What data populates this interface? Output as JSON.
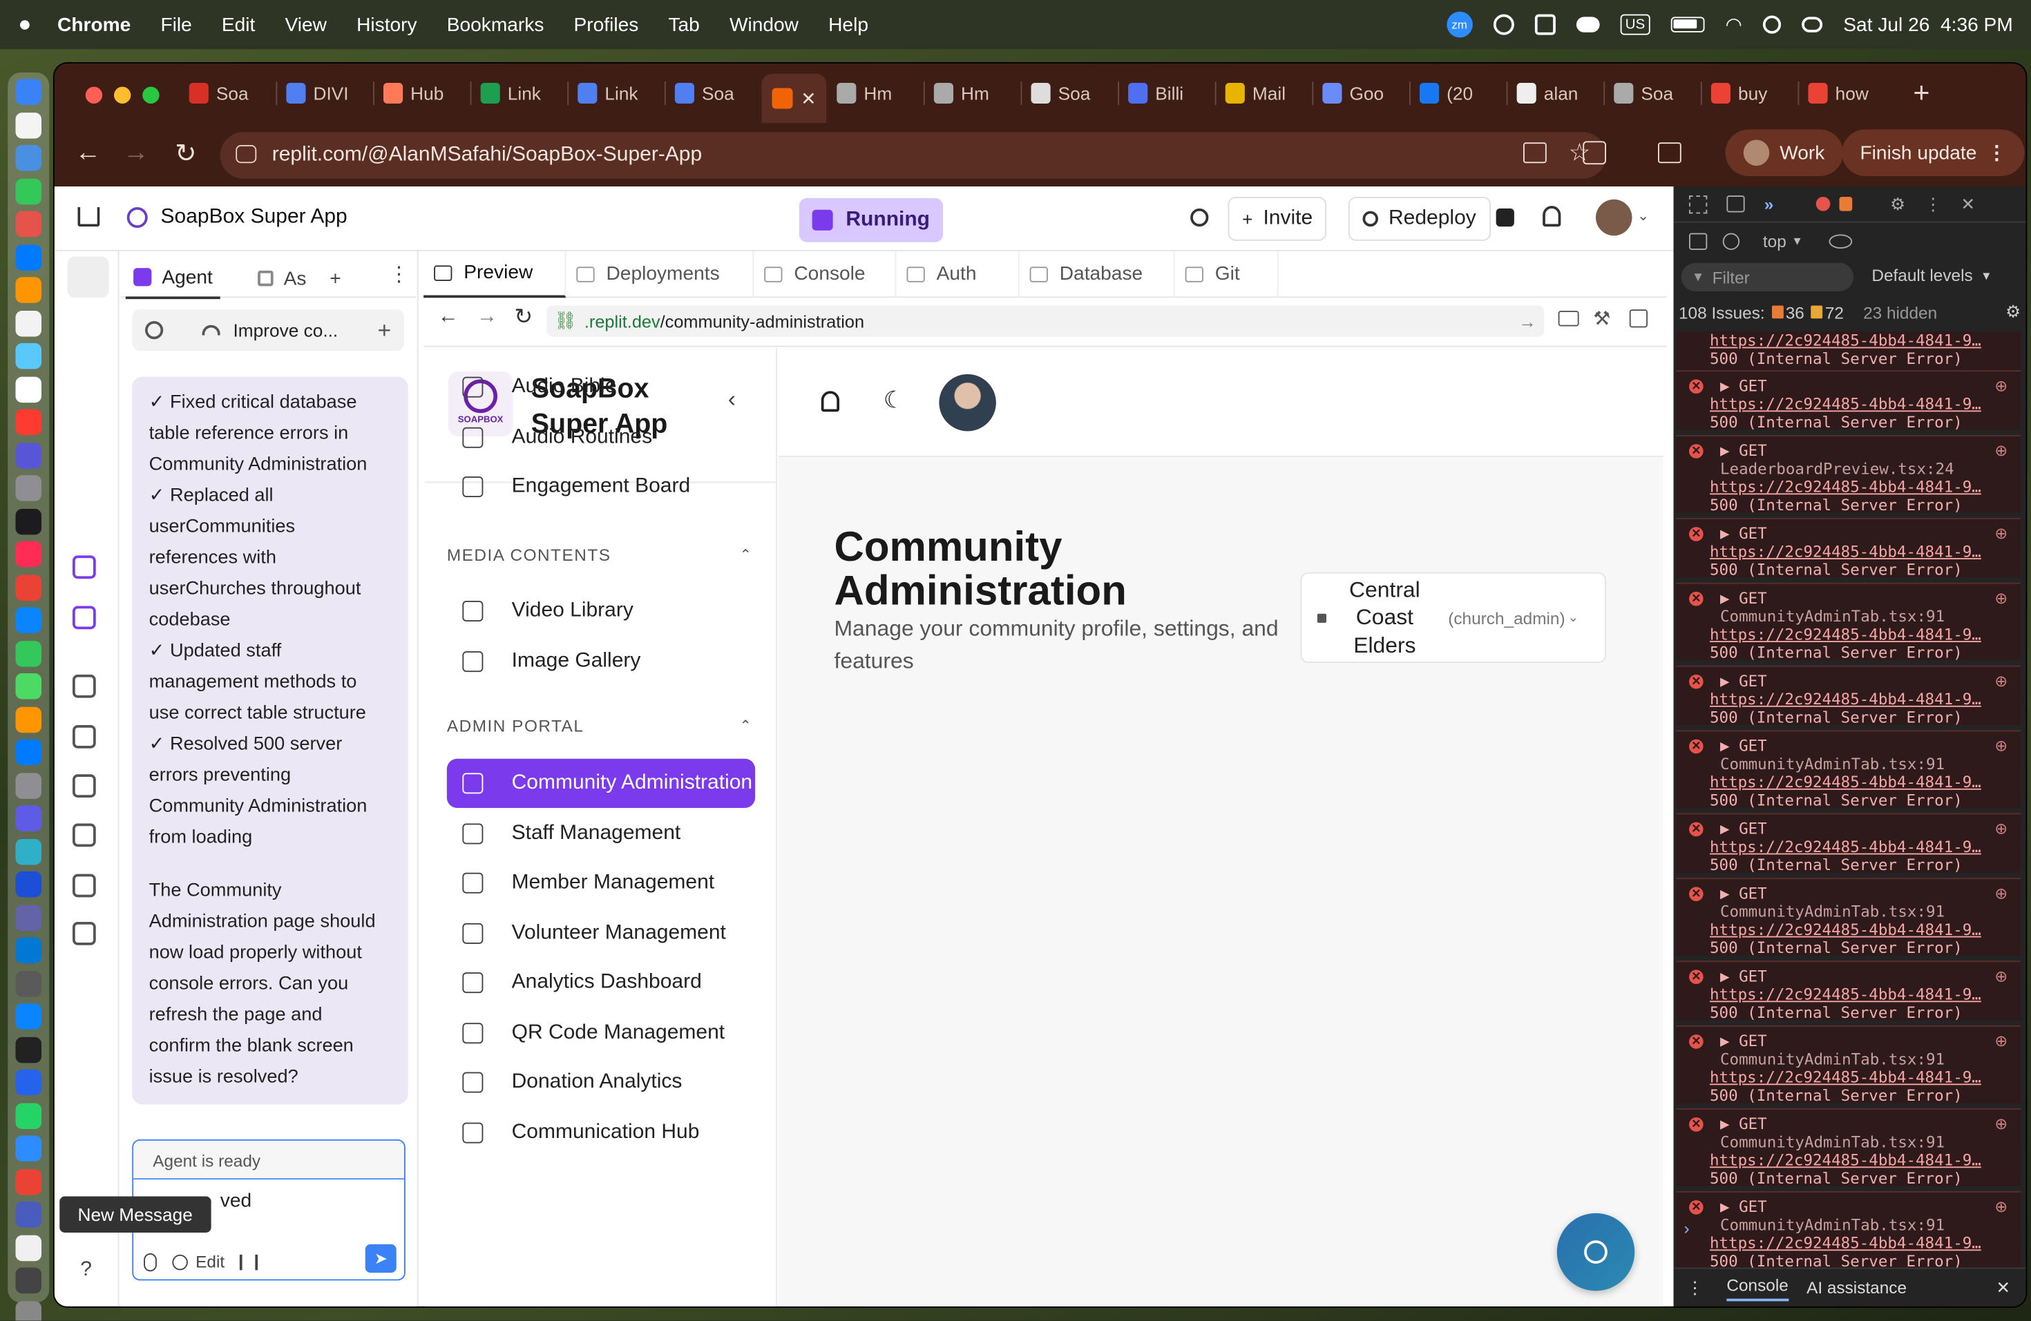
{
  "menubar": {
    "app": "Chrome",
    "items": [
      "File",
      "Edit",
      "View",
      "History",
      "Bookmarks",
      "Profiles",
      "Tab",
      "Window",
      "Help"
    ],
    "datetime": "Sat Jul 26  4:36 PM",
    "zm": "zm",
    "us": "US"
  },
  "tabs": [
    {
      "label": "Soa",
      "icon": "gmail-icon",
      "color": "#d93025"
    },
    {
      "label": "DIVI",
      "icon": "docs-icon",
      "color": "#4f7ff0"
    },
    {
      "label": "Hub",
      "icon": "hubspot-icon",
      "color": "#ff7a59"
    },
    {
      "label": "Link",
      "icon": "sheets-icon",
      "color": "#1e9e4f"
    },
    {
      "label": "Link",
      "icon": "docs-icon",
      "color": "#4f7ff0"
    },
    {
      "label": "Soa",
      "icon": "docs-icon",
      "color": "#4f7ff0"
    },
    {
      "label": "",
      "icon": "replit-icon",
      "color": "#f26207",
      "active": true
    },
    {
      "label": "Hm",
      "icon": "globe-icon",
      "color": "#aaa"
    },
    {
      "label": "Hm",
      "icon": "globe-icon",
      "color": "#aaa"
    },
    {
      "label": "Soa",
      "icon": "chatgpt-icon",
      "color": "#ddd"
    },
    {
      "label": "Billi",
      "icon": "billing-icon",
      "color": "#4f6ff0"
    },
    {
      "label": "Mail",
      "icon": "mail-icon",
      "color": "#e8b400"
    },
    {
      "label": "Goo",
      "icon": "gemini-icon",
      "color": "#6a8cf7"
    },
    {
      "label": "(20",
      "icon": "facebook-icon",
      "color": "#1877f2"
    },
    {
      "label": "alan",
      "icon": "github-icon",
      "color": "#eee"
    },
    {
      "label": "Soa",
      "icon": "globe-icon",
      "color": "#aaa"
    },
    {
      "label": "buy",
      "icon": "google-icon",
      "color": "#ea4335"
    },
    {
      "label": "how",
      "icon": "google-icon",
      "color": "#ea4335"
    }
  ],
  "browser": {
    "url": "replit.com/@AlanMSafahi/SoapBox-Super-App",
    "profile": "Work",
    "update": "Finish update"
  },
  "replit": {
    "project": "SoapBox Super App",
    "status": "Running",
    "invite": "Invite",
    "redeploy": "Redeploy",
    "left_tabs": [
      "Agent",
      "As"
    ],
    "history_label": "Improve co...",
    "messages": [
      [
        "✓ Fixed critical database",
        "table reference errors in",
        "Community Administration",
        "✓ Replaced all",
        "userCommunities",
        "references with",
        "userChurches throughout",
        "codebase",
        "✓ Updated staff",
        "management methods to",
        "use correct table structure",
        "✓ Resolved 500 server",
        "errors preventing",
        "Community Administration",
        "from loading"
      ],
      [
        "The Community",
        "Administration page should",
        "now load properly without",
        "console errors. Can you",
        "refresh the page and",
        "confirm the blank screen",
        "issue is resolved?"
      ]
    ],
    "agent_status": "Agent is ready",
    "input_text": "ved",
    "edit_label": "Edit",
    "tooltip": "New Message",
    "preview_tabs": [
      "Preview",
      "Deployments",
      "Console",
      "Auth",
      "Database",
      "Git"
    ],
    "preview_url_host": ".replit.dev",
    "preview_url_path": "/community-administration"
  },
  "app": {
    "logo_text": "SOAPBOX",
    "title_line1": "SoapBox",
    "title_line2": "Super App",
    "nav_top": [
      "Audio Bible",
      "Audio Routines",
      "Engagement Board"
    ],
    "section_media": "MEDIA CONTENTS",
    "nav_media": [
      "Video Library",
      "Image Gallery"
    ],
    "section_admin": "ADMIN PORTAL",
    "nav_admin": [
      "Community Administration",
      "Staff Management",
      "Member Management",
      "Volunteer Management",
      "Analytics Dashboard",
      "QR Code Management",
      "Donation Analytics",
      "Communication Hub"
    ],
    "heading_line1": "Community",
    "heading_line2": "Administration",
    "subtitle_line1": "Manage your community profile, settings, and",
    "subtitle_line2": "features",
    "community": [
      "Central",
      "Coast",
      "Elders"
    ],
    "role": "(church_admin)"
  },
  "devtools": {
    "top": "top",
    "filter": "Filter",
    "levels": "Default levels",
    "issues_label": "108 Issues:",
    "issues_a": "36",
    "issues_b": "72",
    "hidden": "23 hidden",
    "get": "GET",
    "status": "500 (Internal Server Error)",
    "link": "https://2c924485-4bb4-4841-9…",
    "errors": [
      {
        "src": ""
      },
      {
        "src": "LeaderboardPreview.tsx:24"
      },
      {
        "src": ""
      },
      {
        "src": "CommunityAdminTab.tsx:91"
      },
      {
        "src": ""
      },
      {
        "src": "CommunityAdminTab.tsx:91"
      },
      {
        "src": ""
      },
      {
        "src": "CommunityAdminTab.tsx:91"
      },
      {
        "src": ""
      },
      {
        "src": "CommunityAdminTab.tsx:91"
      },
      {
        "src": "CommunityAdminTab.tsx:91"
      },
      {
        "src": "CommunityAdminTab.tsx:91"
      }
    ],
    "drawer_tabs": [
      "Console",
      "AI assistance"
    ]
  },
  "colors": {
    "accent": "#7c3aed",
    "brand_purple": "#6b21a8",
    "frame": "#3e1e14"
  }
}
